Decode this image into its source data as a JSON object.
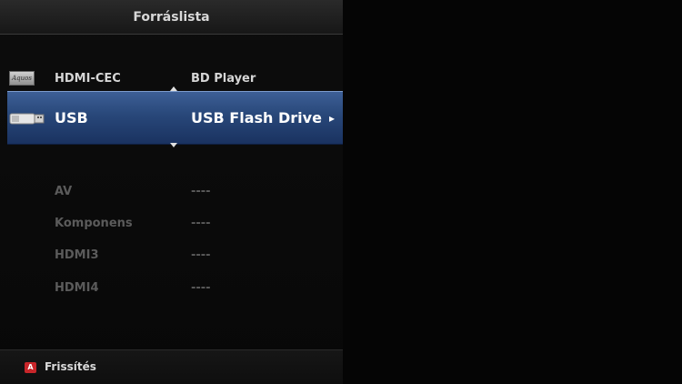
{
  "header": {
    "title": "Forráslista"
  },
  "sources": [
    {
      "name": "HDMI-CEC",
      "device": "BD Player",
      "icon": "hdmi-cec-logo-icon",
      "logo_text": "Aquos"
    },
    {
      "name": "USB",
      "device": "USB Flash Drive",
      "icon": "usb-icon",
      "selected": true
    },
    {
      "name": "AV",
      "device": "----"
    },
    {
      "name": "Komponens",
      "device": "----"
    },
    {
      "name": "HDMI3",
      "device": "----"
    },
    {
      "name": "HDMI4",
      "device": "----"
    }
  ],
  "footer": {
    "key_label": "A",
    "action_label": "Frissítés"
  },
  "colors": {
    "highlight": "#284779",
    "red_key": "#c8262a",
    "dim_text": "#5b5b5b"
  }
}
